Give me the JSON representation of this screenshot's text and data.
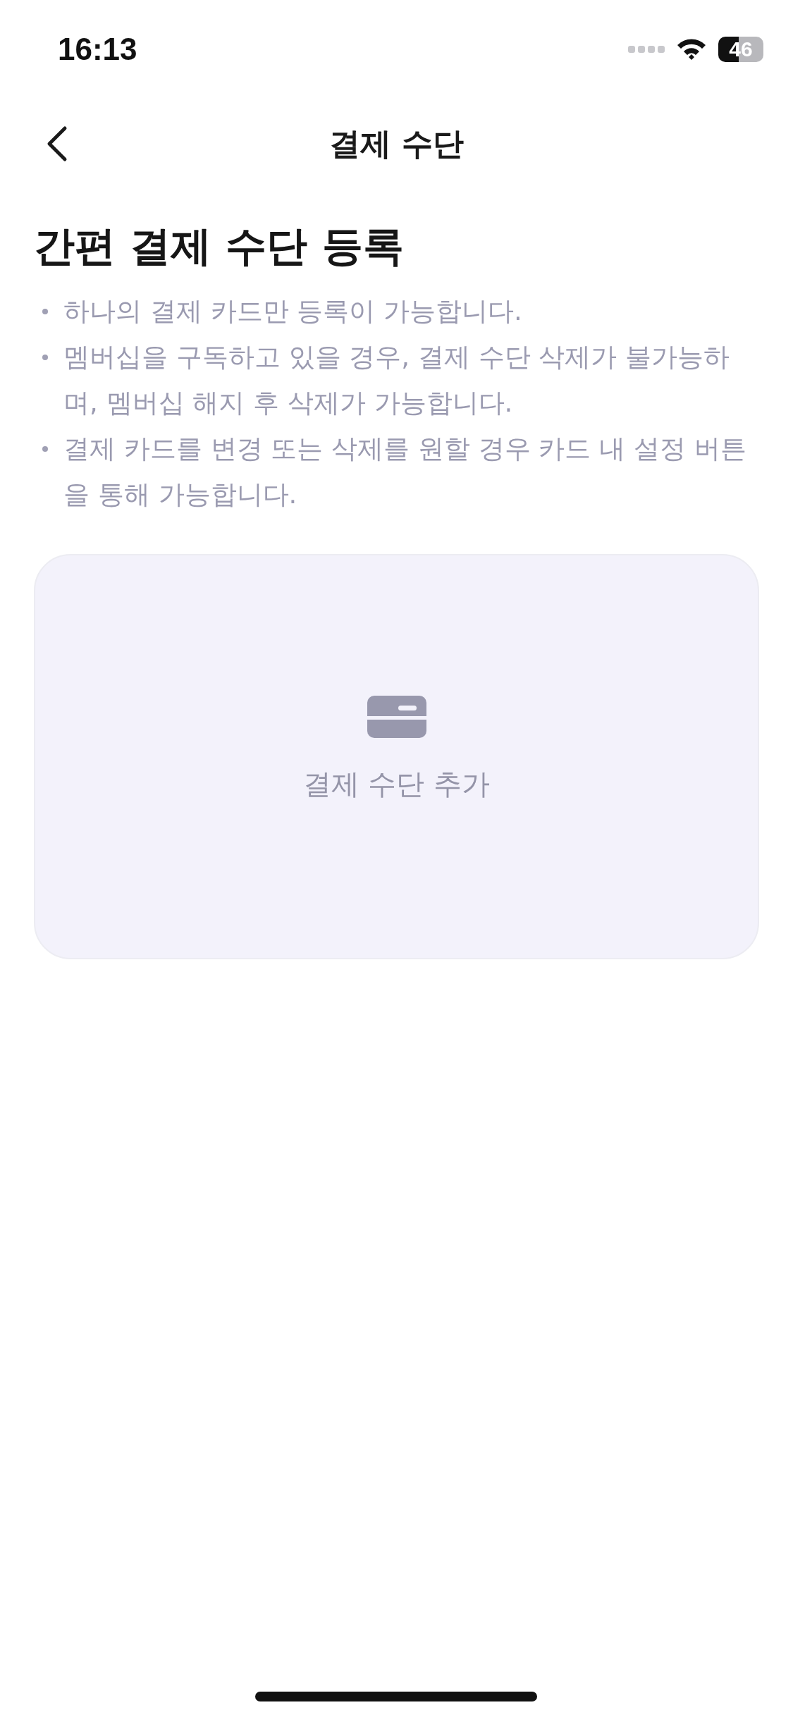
{
  "status_bar": {
    "time": "16:13",
    "battery": "46"
  },
  "nav": {
    "title": "결제 수단"
  },
  "section": {
    "title": "간편 결제 수단 등록",
    "notes": [
      "하나의 결제 카드만 등록이 가능합니다.",
      "멤버십을 구독하고 있을 경우, 결제 수단 삭제가 불가능하며, 멤버십 해지 후 삭제가 가능합니다.",
      "결제 카드를 변경 또는 삭제를 원할 경우 카드 내 설정 버튼을 통해 가능합니다."
    ]
  },
  "add_card": {
    "label": "결제 수단 추가"
  }
}
